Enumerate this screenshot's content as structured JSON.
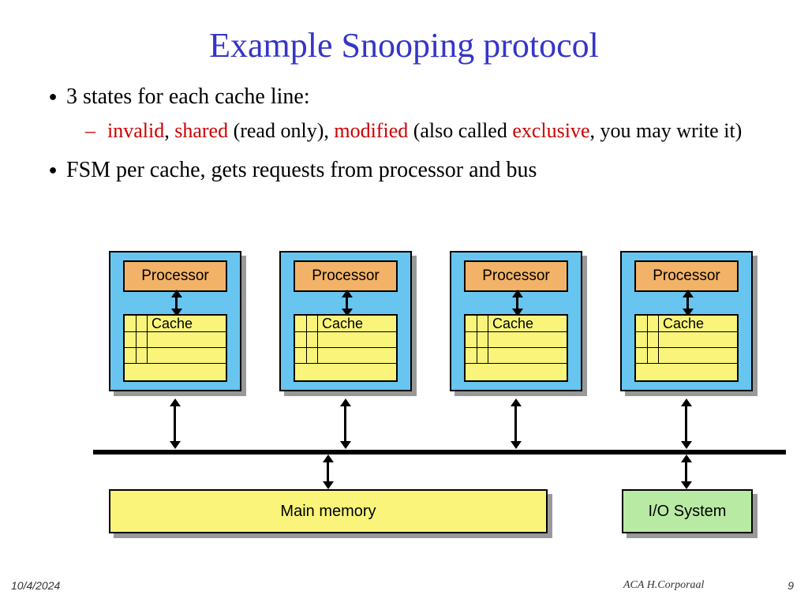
{
  "title": "Example Snooping protocol",
  "bullets": {
    "b1": "3 states for each cache line:",
    "sub_invalid": "invalid",
    "sub_shared": "shared",
    "sub_readonly": " (read only), ",
    "sub_modified": "modified",
    "sub_also": " (also called ",
    "sub_exclusive": "exclusive",
    "sub_tail": ", you may write it)",
    "b2": "FSM per cache, gets requests from processor and bus"
  },
  "labels": {
    "processor": "Processor",
    "cache": "Cache",
    "mainmem": "Main memory",
    "iosys": "I/O System"
  },
  "footer": {
    "date": "10/4/2024",
    "author": "ACA H.Corporaal",
    "page": "9"
  },
  "chart_data": {
    "type": "diagram",
    "title": "Snooping cache coherence architecture",
    "description": "Four identical processor/cache units connected to a shared bus; the bus also connects to Main memory and an I/O System. Double-headed arrows indicate bidirectional communication between each processor and its cache, between each unit and the bus, and between the bus and both Main memory and I/O System.",
    "units": [
      {
        "processor": "Processor",
        "local": "Cache"
      },
      {
        "processor": "Processor",
        "local": "Cache"
      },
      {
        "processor": "Processor",
        "local": "Cache"
      },
      {
        "processor": "Processor",
        "local": "Cache"
      }
    ],
    "shared_bus_connects": [
      "unit0",
      "unit1",
      "unit2",
      "unit3",
      "Main memory",
      "I/O System"
    ],
    "components": {
      "main_memory": "Main memory",
      "io_system": "I/O System"
    }
  }
}
